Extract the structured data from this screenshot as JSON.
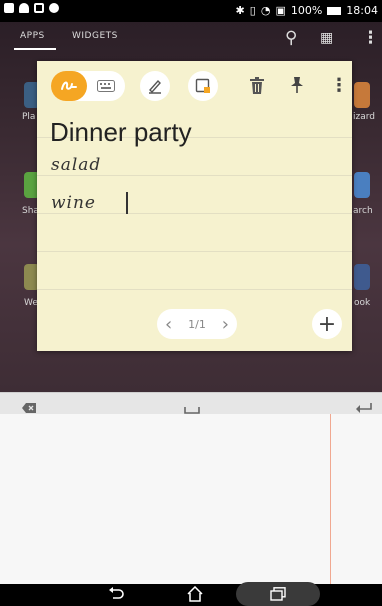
{
  "status_bar": {
    "battery": "100%",
    "time": "18:04"
  },
  "drawer": {
    "tabs": {
      "apps": "APPS",
      "widgets": "WIDGETS"
    },
    "side_labels": {
      "left": [
        "Pla",
        "Sha",
        "We"
      ],
      "right": [
        "izard",
        "arch",
        "ook"
      ]
    }
  },
  "note": {
    "title": "Dinner party",
    "handwritten_lines": [
      "salad",
      "wine"
    ],
    "page_indicator": "1/1",
    "prev_glyph": "‹",
    "next_glyph": "›",
    "add_glyph": "+"
  },
  "icons": {
    "handwriting": "handwriting-icon",
    "keyboard": "keyboard-icon",
    "pen": "pen-icon",
    "color": "note-color-icon",
    "delete": "trash-icon",
    "pin": "pin-icon",
    "more": "more-icon"
  },
  "colors": {
    "accent": "#f5a623",
    "note_bg": "#f6f2cf"
  }
}
